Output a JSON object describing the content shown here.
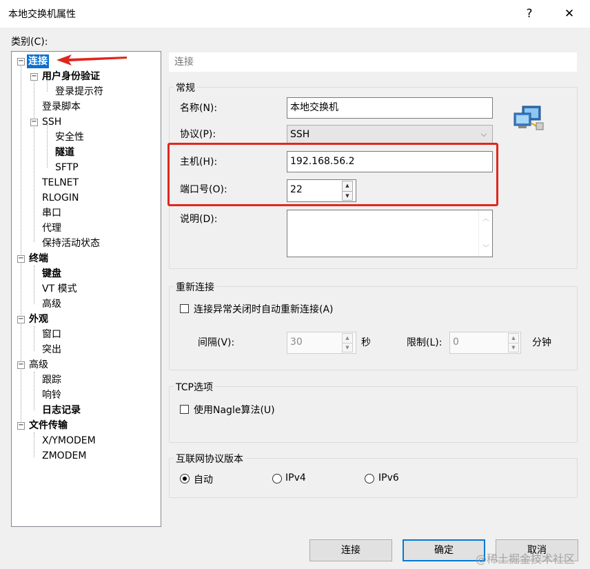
{
  "window": {
    "title": "本地交换机属性",
    "help_glyph": "?",
    "close_glyph": "✕"
  },
  "category_label": "类别(C):",
  "tree": {
    "items": [
      {
        "label": "连接"
      },
      {
        "label": "用户身份验证"
      },
      {
        "label": "登录提示符"
      },
      {
        "label": "登录脚本"
      },
      {
        "label": "SSH"
      },
      {
        "label": "安全性"
      },
      {
        "label": "隧道"
      },
      {
        "label": "SFTP"
      },
      {
        "label": "TELNET"
      },
      {
        "label": "RLOGIN"
      },
      {
        "label": "串口"
      },
      {
        "label": "代理"
      },
      {
        "label": "保持活动状态"
      },
      {
        "label": "终端"
      },
      {
        "label": "键盘"
      },
      {
        "label": "VT 模式"
      },
      {
        "label": "高级"
      },
      {
        "label": "外观"
      },
      {
        "label": "窗口"
      },
      {
        "label": "突出"
      },
      {
        "label": "高级"
      },
      {
        "label": "跟踪"
      },
      {
        "label": "响铃"
      },
      {
        "label": "日志记录"
      },
      {
        "label": "文件传输"
      },
      {
        "label": "X/YMODEM"
      },
      {
        "label": "ZMODEM"
      }
    ]
  },
  "panel": {
    "header": "连接",
    "general": {
      "title": "常规",
      "name_label": "名称(N):",
      "name_value": "本地交换机",
      "protocol_label": "协议(P):",
      "protocol_value": "SSH",
      "host_label": "主机(H):",
      "host_value": "192.168.56.2",
      "port_label": "端口号(O):",
      "port_value": "22",
      "desc_label": "说明(D):",
      "desc_value": ""
    },
    "reconnect": {
      "title": "重新连接",
      "checkbox_label": "连接异常关闭时自动重新连接(A)",
      "interval_label": "间隔(V):",
      "interval_value": "30",
      "interval_unit": "秒",
      "limit_label": "限制(L):",
      "limit_value": "0",
      "limit_unit": "分钟"
    },
    "tcp": {
      "title": "TCP选项",
      "nagle_label": "使用Nagle算法(U)"
    },
    "ipver": {
      "title": "互联网协议版本",
      "options": [
        "自动",
        "IPv4",
        "IPv6"
      ]
    }
  },
  "buttons": {
    "connect": "连接",
    "ok": "确定",
    "cancel": "取消"
  },
  "watermark": "@稀土掘金技术社区",
  "colors": {
    "selection": "#0b6fd2",
    "annotation_red": "#e0261d",
    "default_button_border": "#0078d7"
  }
}
